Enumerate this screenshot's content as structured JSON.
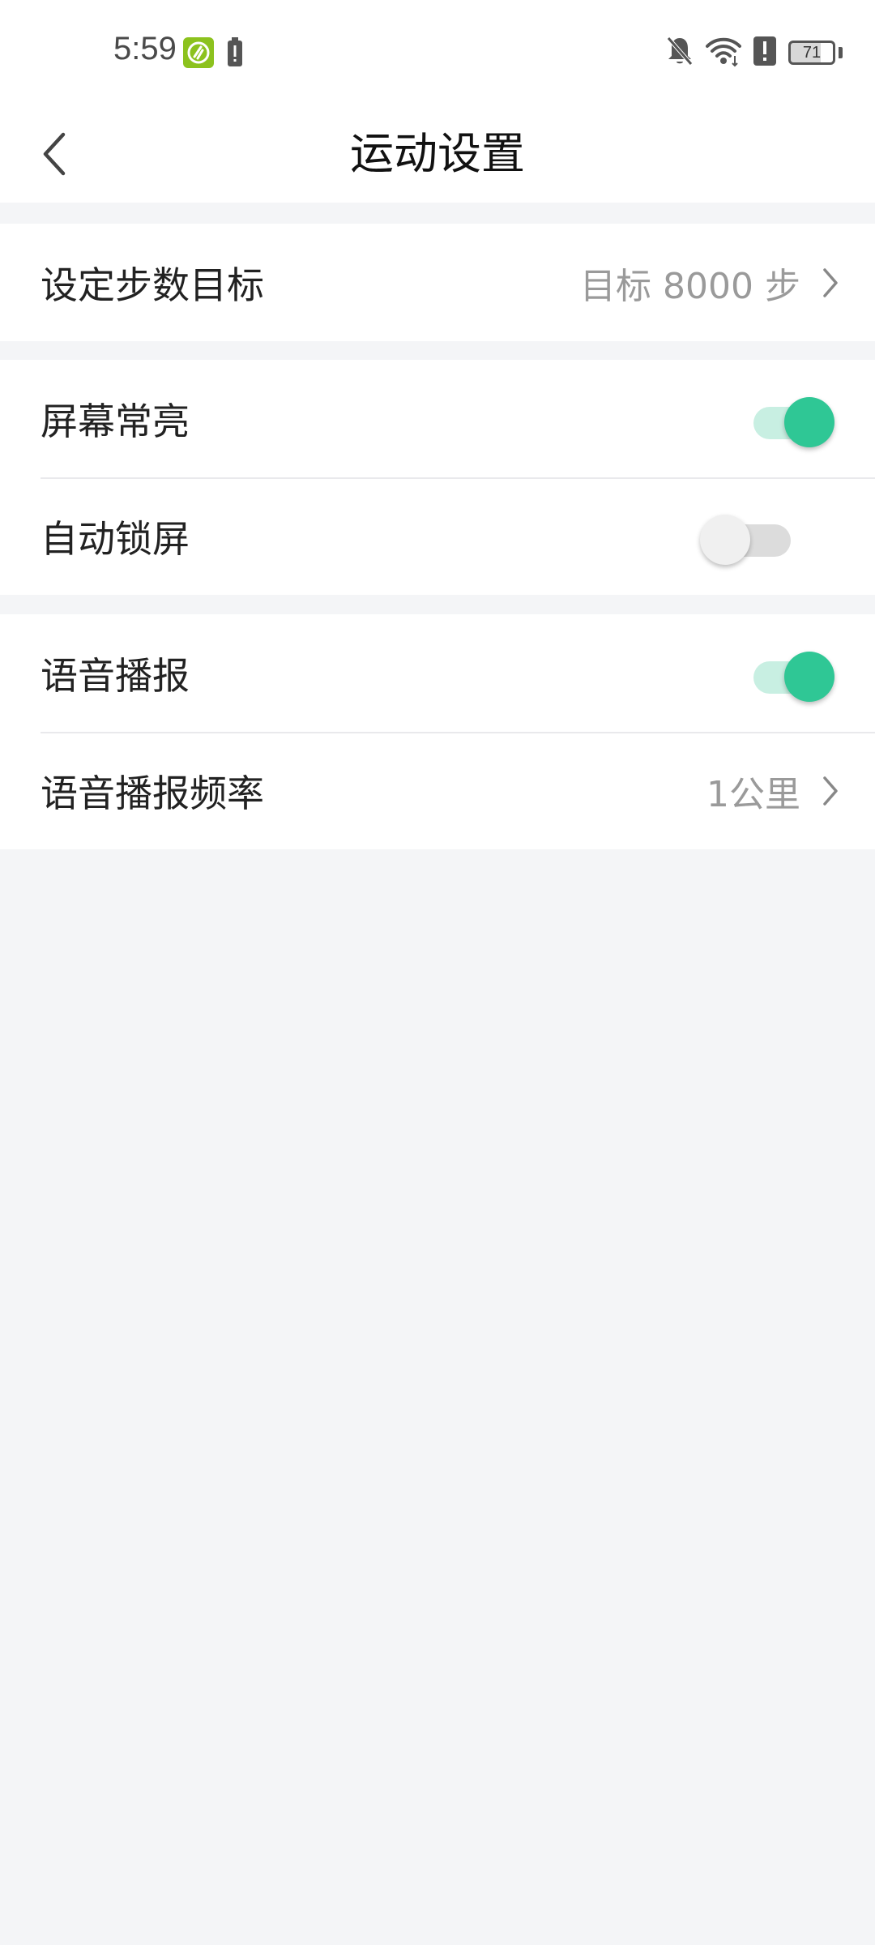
{
  "status_bar": {
    "time": "5:59",
    "battery_level": "71"
  },
  "header": {
    "title": "运动设置"
  },
  "groups": [
    {
      "rows": [
        {
          "label": "设定步数目标",
          "value": "目标 8000 步"
        }
      ]
    },
    {
      "rows": [
        {
          "label": "屏幕常亮",
          "toggle_on": true
        },
        {
          "label": "自动锁屏",
          "toggle_on": false
        }
      ]
    },
    {
      "rows": [
        {
          "label": "语音播报",
          "toggle_on": true
        },
        {
          "label": "语音播报频率",
          "value": "1公里"
        }
      ]
    }
  ],
  "colors": {
    "accent": "#2fc795",
    "accent_track": "#c8efe2",
    "background": "#f4f5f7"
  }
}
